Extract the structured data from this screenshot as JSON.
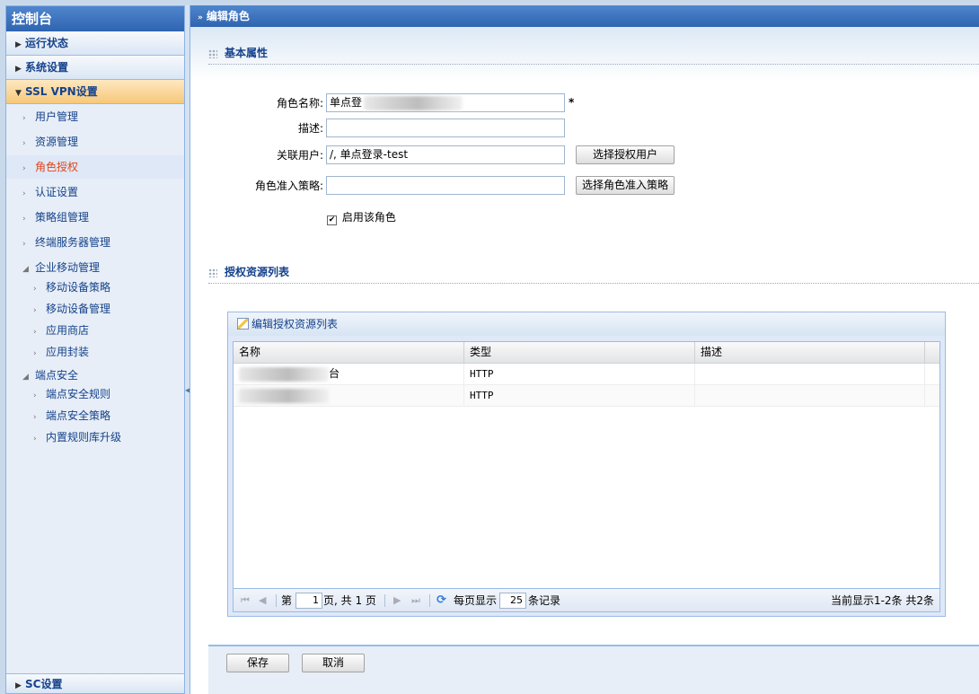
{
  "sidebar": {
    "title": "控制台",
    "groups": {
      "run_status": "运行状态",
      "system_settings": "系统设置",
      "ssl_vpn": "SSL VPN设置"
    },
    "items": {
      "user_mgmt": "用户管理",
      "resource_mgmt": "资源管理",
      "role_auth": "角色授权",
      "auth_settings": "认证设置",
      "policy_group": "策略组管理",
      "terminal_server": "终端服务器管理",
      "enterprise_mobile": "企业移动管理",
      "mobile_device_policy": "移动设备策略",
      "mobile_device_mgmt": "移动设备管理",
      "app_store": "应用商店",
      "app_wrap": "应用封装",
      "endpoint_security": "端点安全",
      "endpoint_rules": "端点安全规则",
      "endpoint_policy": "端点安全策略",
      "builtin_rules": "内置规则库升级"
    },
    "bottom_group": "SC设置"
  },
  "main": {
    "header": "编辑角色",
    "basic_section": "基本属性",
    "form": {
      "role_name_label": "角色名称:",
      "role_name_value": "单点登",
      "required_mark": "*",
      "desc_label": "描述:",
      "desc_value": "",
      "users_label": "关联用户:",
      "users_value": "/, 单点登录-test",
      "select_users_btn": "选择授权用户",
      "policy_label": "角色准入策略:",
      "policy_value": "",
      "select_policy_btn": "选择角色准入策略",
      "enable_label": "启用该角色",
      "enable_checked": true
    },
    "resource_section": "授权资源列表",
    "grid_panel": {
      "title": "编辑授权资源列表",
      "columns": [
        "名称",
        "类型",
        "描述"
      ],
      "rows": [
        {
          "name_suffix": "台",
          "type": "HTTP",
          "desc": ""
        },
        {
          "name_suffix": "",
          "type": "HTTP",
          "desc": ""
        }
      ],
      "pager": {
        "page_prefix": "第",
        "page_value": "1",
        "page_suffix": "页, 共 1 页",
        "per_page_label": "每页显示",
        "per_page_value": "25",
        "records_label": "条记录",
        "summary": "当前显示1-2条 共2条"
      }
    },
    "buttons": {
      "save": "保存",
      "cancel": "取消"
    }
  }
}
